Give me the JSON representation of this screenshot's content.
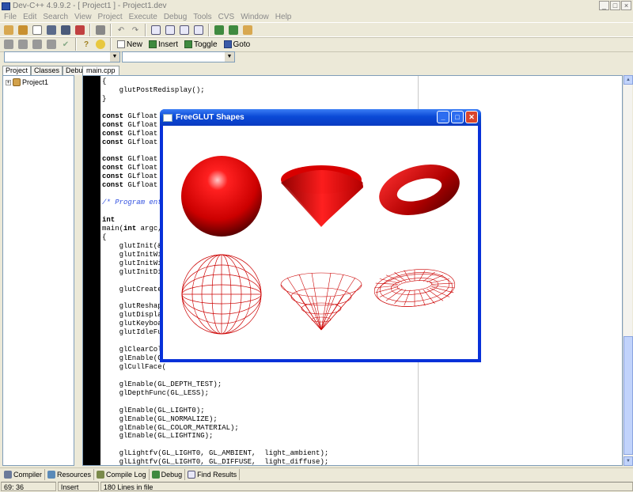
{
  "window": {
    "title": "Dev-C++ 4.9.9.2  - [ Project1 ] - Project1.dev"
  },
  "menu": [
    "File",
    "Edit",
    "Search",
    "View",
    "Project",
    "Execute",
    "Debug",
    "Tools",
    "CVS",
    "Window",
    "Help"
  ],
  "toolbar2": {
    "new_label": "New",
    "insert_label": "Insert",
    "toggle_label": "Toggle",
    "goto_label": "Goto"
  },
  "left_panel": {
    "tabs": [
      "Project",
      "Classes",
      "Debug"
    ],
    "tree_item": "Project1"
  },
  "editor": {
    "tab": "main.cpp",
    "lines": [
      "{",
      "    glutPostRedisplay();",
      "}",
      "",
      "const GLfloat l",
      "const GLfloat l",
      "const GLfloat l",
      "const GLfloat l",
      "",
      "const GLfloat m",
      "const GLfloat m",
      "const GLfloat m",
      "const GLfloat h",
      "",
      "/* Program entr",
      "",
      "int",
      "main(int argc,",
      "{",
      "    glutInit(&a",
      "    glutInitWin",
      "    glutInitWin",
      "    glutInitDis",
      "",
      "    glutCreateW",
      "",
      "    glutReshape",
      "    glutDisplay",
      "    glutKeyboar",
      "    glutIdleFun",
      "",
      "    glClearColo",
      "    glEnable(GL",
      "    glCullFace(",
      "",
      "    glEnable(GL_DEPTH_TEST);",
      "    glDepthFunc(GL_LESS);",
      "",
      "    glEnable(GL_LIGHT0);",
      "    glEnable(GL_NORMALIZE);",
      "    glEnable(GL_COLOR_MATERIAL);",
      "    glEnable(GL_LIGHTING);",
      "",
      "    glLightfv(GL_LIGHT0, GL_AMBIENT,  light_ambient);",
      "    glLightfv(GL_LIGHT0, GL_DIFFUSE,  light_diffuse);",
      "    glLightfv(GL_LIGHT0, GL_SPECULAR, light_specular);"
    ]
  },
  "glut_window": {
    "title": "FreeGLUT Shapes"
  },
  "bottom_tabs": [
    "Compiler",
    "Resources",
    "Compile Log",
    "Debug",
    "Find Results"
  ],
  "status": {
    "position": "69: 36",
    "mode": "Insert",
    "lines": "180 Lines in file"
  },
  "colors": {
    "shape_red": "#e00000",
    "wire_red": "#cc0000",
    "xp_blue": "#0a49d6"
  }
}
